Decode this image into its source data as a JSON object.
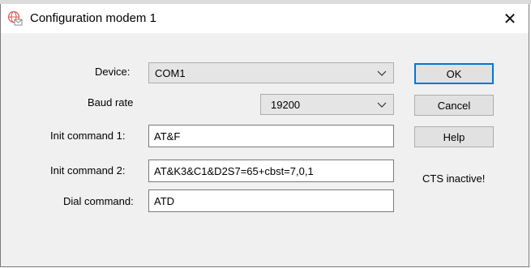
{
  "window": {
    "title": "Configuration modem 1",
    "close_glyph": "✕",
    "icons": {
      "title": "network-globe-icon",
      "close": "close-icon"
    }
  },
  "form": {
    "device": {
      "label": "Device:",
      "value": "COM1"
    },
    "baud_rate": {
      "label": "Baud rate",
      "value": "19200"
    },
    "init_command_1": {
      "label": "Init command 1:",
      "value": "AT&F"
    },
    "init_command_2": {
      "label": "Init command 2:",
      "value": "AT&K3&C1&D2S7=65+cbst=7,0,1"
    },
    "dial_command": {
      "label": "Dial command:",
      "value": "ATD"
    }
  },
  "buttons": {
    "ok": "OK",
    "cancel": "Cancel",
    "help": "Help"
  },
  "status": {
    "cts": "CTS inactive!"
  },
  "colors": {
    "accent": "#0078d7",
    "dialog_bg": "#f0f0f0",
    "field_border": "#7a7a7a"
  }
}
